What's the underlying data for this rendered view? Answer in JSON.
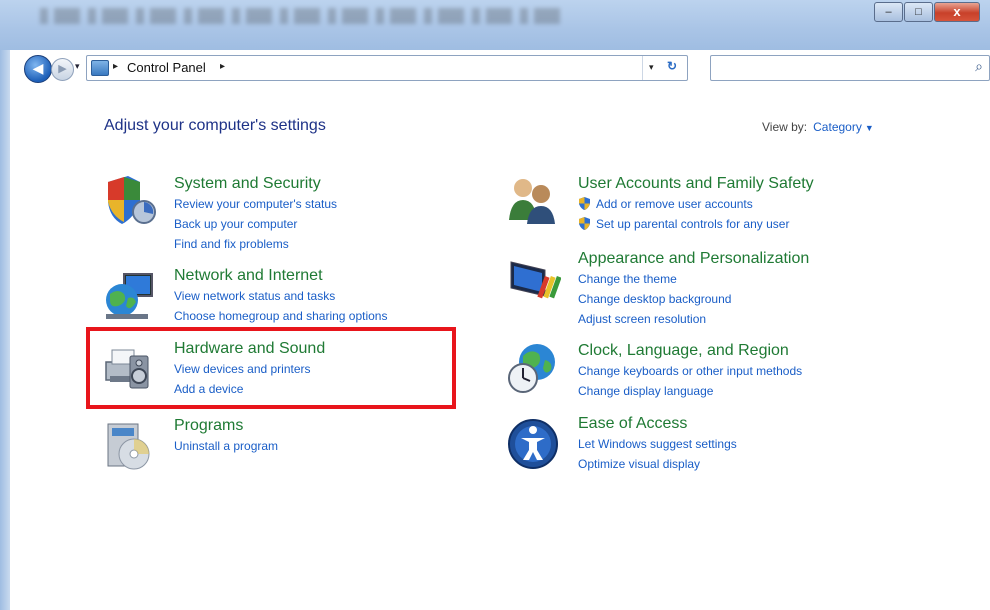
{
  "window": {
    "controls": {
      "minimize": "–",
      "maximize": "□",
      "close": "x"
    }
  },
  "nav": {
    "back_icon": "arrow-left-icon",
    "forward_icon": "arrow-right-icon",
    "breadcrumb": "Control Panel",
    "separator": "▸",
    "dropdown": "▾",
    "refresh": "↻",
    "search_placeholder": "",
    "search_icon": "⌕"
  },
  "header": {
    "title": "Adjust your computer's settings",
    "view_by_label": "View by:",
    "view_by_value": "Category",
    "view_by_arrow": "▼"
  },
  "categories_left": [
    {
      "title": "System and Security",
      "links": [
        "Review your computer's status",
        "Back up your computer",
        "Find and fix problems"
      ],
      "icon": "shield-icon"
    },
    {
      "title": "Network and Internet",
      "links": [
        "View network status and tasks",
        "Choose homegroup and sharing options"
      ],
      "icon": "globe-network-icon"
    },
    {
      "title": "Hardware and Sound",
      "links": [
        "View devices and printers",
        "Add a device"
      ],
      "icon": "printer-speaker-icon"
    },
    {
      "title": "Programs",
      "links": [
        "Uninstall a program"
      ],
      "icon": "programs-disc-icon"
    }
  ],
  "categories_right": [
    {
      "title": "User Accounts and Family Safety",
      "links": [
        "Add or remove user accounts",
        "Set up parental controls for any user"
      ],
      "icon": "users-icon"
    },
    {
      "title": "Appearance and Personalization",
      "links": [
        "Change the theme",
        "Change desktop background",
        "Adjust screen resolution"
      ],
      "icon": "monitor-paint-icon"
    },
    {
      "title": "Clock, Language, and Region",
      "links": [
        "Change keyboards or other input methods",
        "Change display language"
      ],
      "icon": "globe-clock-icon"
    },
    {
      "title": "Ease of Access",
      "links": [
        "Let Windows suggest settings",
        "Optimize visual display"
      ],
      "icon": "ease-of-access-icon"
    }
  ],
  "colors": {
    "category_title": "#1f7a34",
    "link": "#1a5ec7",
    "heading": "#1e3287",
    "highlight": "#e8151b"
  }
}
